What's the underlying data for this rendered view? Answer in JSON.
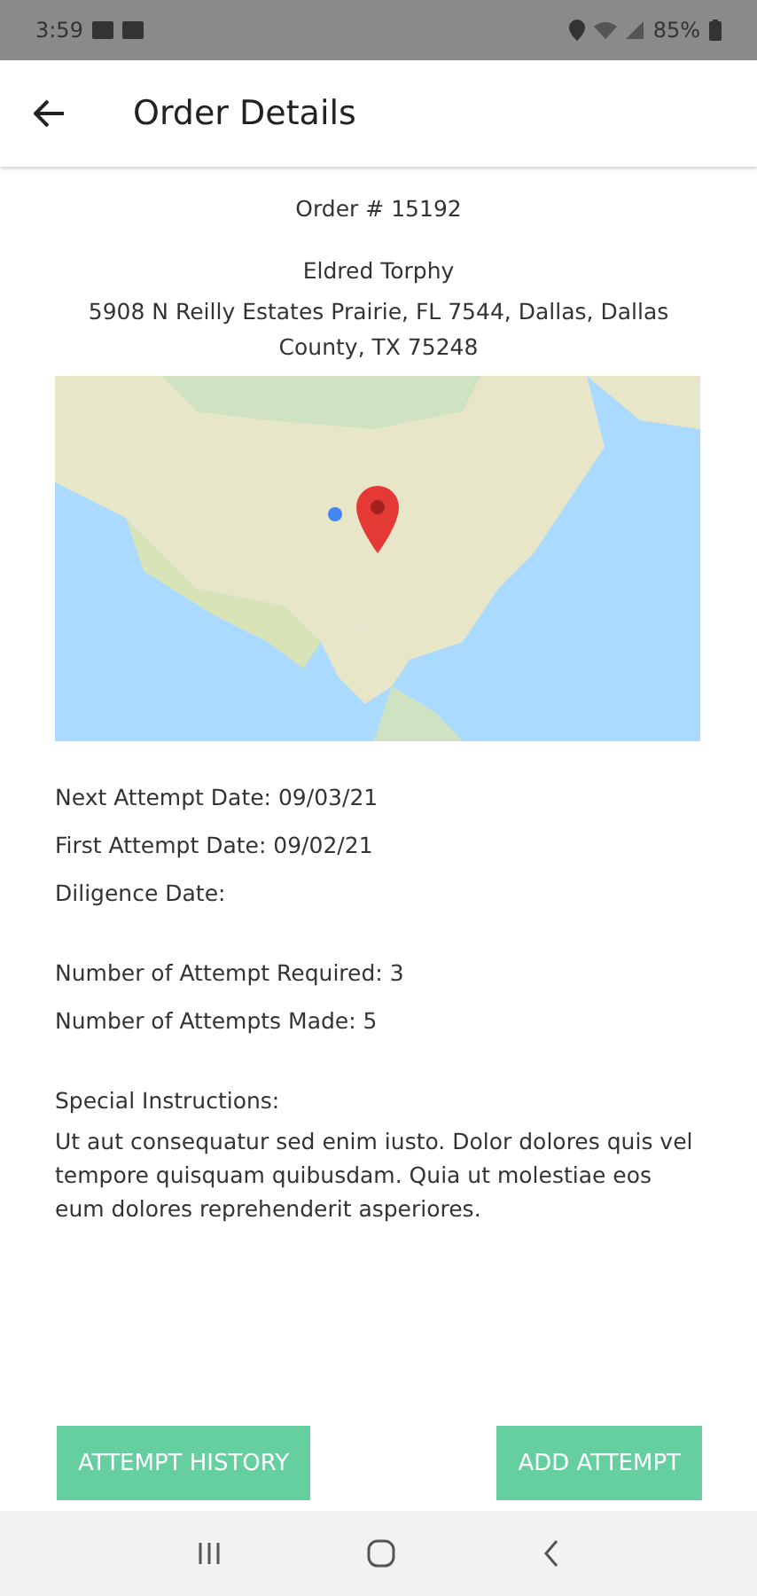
{
  "status_bar": {
    "time": "3:59",
    "battery": "85%"
  },
  "app_bar": {
    "title": "Order Details"
  },
  "order": {
    "number": "Order # 15192",
    "name": "Eldred Torphy",
    "address": "5908 N Reilly Estates Prairie, FL 7544, Dallas, Dallas County, TX 75248"
  },
  "map": {
    "kind": "picture"
  },
  "dates": [
    "Next Attempt Date: 09/03/21",
    "First Attempt Date: 09/02/21",
    "Diligence Date:"
  ],
  "attempts": [
    "Number of Attempt Required: 3",
    "Number of Attempts Made: 5"
  ],
  "special_instructions": {
    "label": "Special Instructions:",
    "text": "Ut aut consequatur sed enim iusto. Dolor dolores quis vel tempore quisquam quibusdam. Quia ut molestiae eos eum dolores reprehenderit asperiores."
  },
  "buttons": [
    "ATTEMPT HISTORY",
    "ADD ATTEMPT"
  ]
}
